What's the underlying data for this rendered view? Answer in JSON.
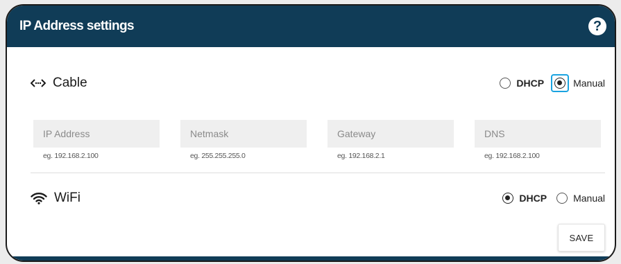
{
  "header": {
    "title": "IP Address settings",
    "help_icon": "help-icon"
  },
  "cable": {
    "icon": "ethernet-code-icon",
    "title": "Cable",
    "options": [
      {
        "label": "DHCP",
        "checked": false
      },
      {
        "label": "Manual",
        "checked": true,
        "focused": true
      }
    ],
    "fields": [
      {
        "placeholder": "IP Address",
        "hint": "eg. 192.168.2.100"
      },
      {
        "placeholder": "Netmask",
        "hint": "eg. 255.255.255.0"
      },
      {
        "placeholder": "Gateway",
        "hint": "eg. 192.168.2.1"
      },
      {
        "placeholder": "DNS",
        "hint": "eg. 192.168.2.100"
      }
    ]
  },
  "wifi": {
    "icon": "wifi-icon",
    "title": "WiFi",
    "options": [
      {
        "label": "DHCP",
        "checked": true
      },
      {
        "label": "Manual",
        "checked": false
      }
    ]
  },
  "save_label": "SAVE",
  "colors": {
    "header_bg": "#103c57",
    "focus_ring": "#1aa3e0",
    "field_bg": "#efefef"
  }
}
